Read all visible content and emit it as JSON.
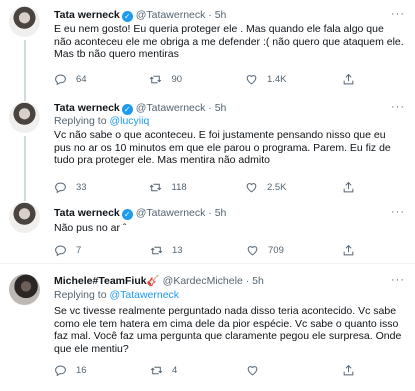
{
  "tweets": [
    {
      "name": "Tata werneck",
      "handle": "@Tatawerneck",
      "dot": "·",
      "time": "5h",
      "reply_prefix": "",
      "reply_to": "",
      "text": "E eu nem gosto! Eu queria proteger ele . Mas quando ele fala algo que não aconteceu ele me obriga a me defender :( não quero que ataquem ele. Mas tb não quero mentiras",
      "replies": "64",
      "retweets": "90",
      "likes": "1.4K"
    },
    {
      "name": "Tata werneck",
      "handle": "@Tatawerneck",
      "dot": "·",
      "time": "5h",
      "reply_prefix": "Replying to",
      "reply_to": "@lucyiiq",
      "text": "Vc não sabe o que aconteceu. E foi justamente pensando nisso que eu pus no ar os 10 minutos em que ele parou o programa. Parem. Eu fiz de tudo pra proteger ele. Mas mentira não admito",
      "replies": "33",
      "retweets": "118",
      "likes": "2.5K"
    },
    {
      "name": "Tata werneck",
      "handle": "@Tatawerneck",
      "dot": "·",
      "time": "5h",
      "reply_prefix": "",
      "reply_to": "",
      "text": "Não pus no ar ˆ",
      "replies": "7",
      "retweets": "13",
      "likes": "709"
    },
    {
      "name": "Michele#TeamFiuk🎸",
      "handle": "@KardecMichele",
      "dot": "·",
      "time": "5h",
      "reply_prefix": "Replying to",
      "reply_to": "@Tatawerneck",
      "text": "Se vc tivesse realmente perguntado nada disso teria acontecido. Vc sabe como ele tem hatera em cima dele da pior espécie. Vc sabe o quanto isso faz mal. Você faz uma pergunta que claramente pegou ele surpresa. Onde que ele mentiu?",
      "replies": "16",
      "retweets": "4",
      "likes": ""
    }
  ],
  "icons": {
    "verified": "verified-badge-icon",
    "more": "more-dots-icon",
    "reply": "reply-bubble-icon",
    "retweet": "retweet-icon",
    "like": "heart-icon",
    "share": "share-icon"
  },
  "colors": {
    "text": "#0f1419",
    "secondary": "#536471",
    "accent": "#1d9bf0",
    "divider": "#eff3f4"
  },
  "glyphs": {
    "verified": "✓",
    "more": "···"
  }
}
